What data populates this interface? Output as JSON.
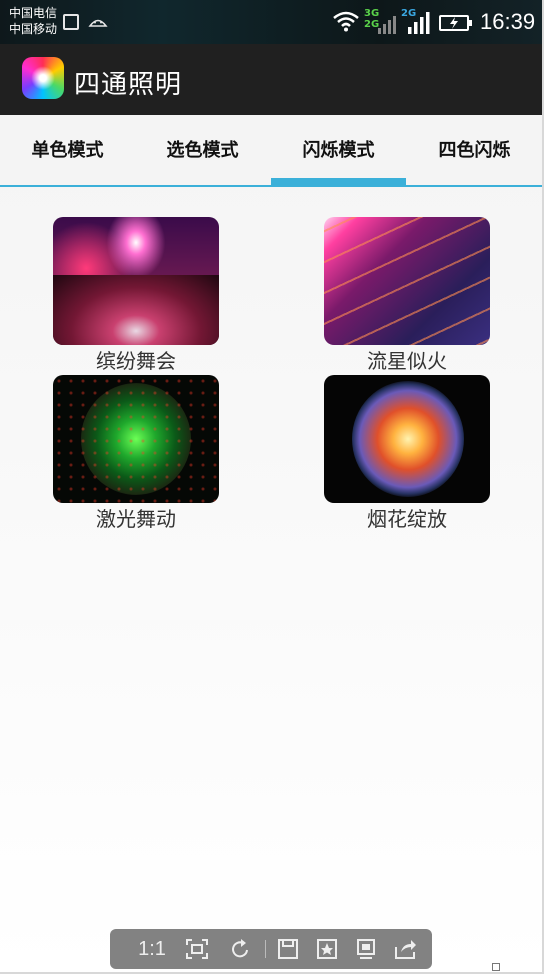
{
  "status_bar": {
    "carrier_1": "中国电信",
    "carrier_2": "中国移动",
    "net_3g": "3G",
    "net_2g_a": "2G",
    "net_2g_b": "2G",
    "time": "16:39"
  },
  "app_bar": {
    "title": "四通照明",
    "logo_icon": "rainbow-star-app-icon"
  },
  "tabs": [
    {
      "label": "单色模式",
      "active": false
    },
    {
      "label": "选色模式",
      "active": false
    },
    {
      "label": "闪烁模式",
      "active": true
    },
    {
      "label": "四色闪烁",
      "active": false
    }
  ],
  "accent_color": "#3bb0d9",
  "effects": [
    {
      "label": "缤纷舞会",
      "icon": "party-crowd-image"
    },
    {
      "label": "流星似火",
      "icon": "meteor-streaks-image"
    },
    {
      "label": "激光舞动",
      "icon": "green-laser-image"
    },
    {
      "label": "烟花绽放",
      "icon": "firework-burst-image"
    }
  ],
  "viewer_toolbar": {
    "ratio_label": "1:1",
    "icons": [
      "fit-screen-icon",
      "rotate-icon",
      "save-icon",
      "favorite-icon",
      "slideshow-icon",
      "share-icon"
    ]
  }
}
